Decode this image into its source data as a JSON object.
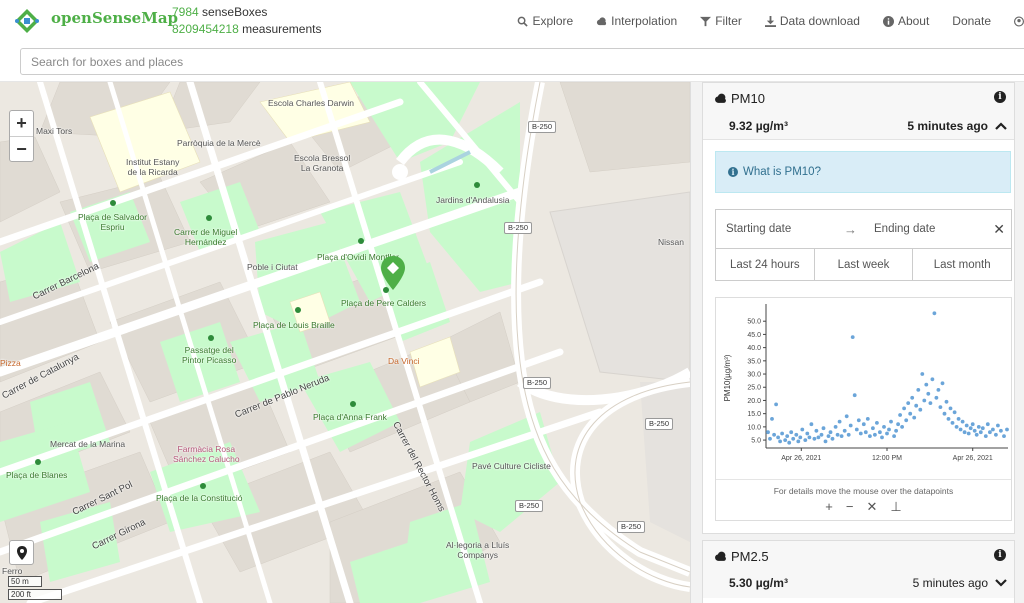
{
  "header": {
    "brand": "openSenseMap",
    "boxes_count": "7984",
    "boxes_label": "senseBoxes",
    "measurements_count": "8209454218",
    "measurements_label": "measurements",
    "nav": [
      {
        "label": "Explore",
        "icon": "search-icon"
      },
      {
        "label": "Interpolation",
        "icon": "cloud-icon"
      },
      {
        "label": "Filter",
        "icon": "filter-icon"
      },
      {
        "label": "Data download",
        "icon": "download-icon"
      },
      {
        "label": "About",
        "icon": "info-icon"
      },
      {
        "label": "Donate",
        "icon": ""
      }
    ],
    "search_placeholder": "Search for boxes and places"
  },
  "map": {
    "labels": {
      "maxi_tors": "Maxi Tors",
      "escola_darwin": "Escola Charles Darwin",
      "parroquia": "Parròquia de la Mercè",
      "institut": "Institut Estany\nde la Ricarda",
      "escola_bressol": "Escola Bressol\nLa Granota",
      "jardins": "Jardins d'Andalusia",
      "placa_salvador": "Plaça de Salvador\nEspriu",
      "carrer_miguel": "Carrer de Miguel\nHernández",
      "poble_ciutat": "Poble i Ciutat",
      "placa_ovidi": "Plaça d'Ovidi Montllor",
      "placa_pere": "Plaça de Pere Calders",
      "nissan": "Nissan",
      "carrer_barcelona": "Carrer Barcelona",
      "placa_louis": "Plaça de Louis Braille",
      "passatge": "Passatge del\nPintor Picasso",
      "da_vinci": "Da Vinci",
      "pizza": "Pizza",
      "carrer_catalunya": "Carrer de Catalunya",
      "carrer_pablo": "Carrer de Pablo Neruda",
      "placa_anna": "Plaça d'Anna Frank",
      "mercat": "Mercat de la Marina",
      "farmacia": "Farmàcia Rosa\nSánchez Calucho",
      "carrer_rector": "Carrer del Rector Homs",
      "pave": "Pavé Culture Cicliste",
      "placa_blanes": "Plaça de Blanes",
      "carrer_sant_pol": "Carrer Sant Pol",
      "placa_constitucio": "Plaça de la Constitució",
      "carrer_girona": "Carrer Girona",
      "alegoria": "Al·legoria a Lluís\nCompanys",
      "ferro": "Ferro"
    },
    "road_shields": [
      "B-250",
      "B-250",
      "B-250",
      "B-250",
      "B-250",
      "B-250"
    ],
    "zoom_in": "+",
    "zoom_out": "−",
    "scale_metric": "50 m",
    "scale_imperial": "200 ft"
  },
  "sidebar": {
    "pm10": {
      "title": "PM10",
      "value": "9.32 µg/m³",
      "updated": "5 minutes ago",
      "what_is": "What is PM10?",
      "start_date": "Starting date",
      "end_date": "Ending date",
      "quick_ranges": [
        "Last 24 hours",
        "Last week",
        "Last month"
      ],
      "hint": "For details move the mouse over the datapoints",
      "tools": [
        "+",
        "−",
        "✕",
        "⊥"
      ]
    },
    "pm25": {
      "title": "PM2.5",
      "value": "5.30 µg/m³",
      "updated": "5 minutes ago"
    }
  },
  "colors": {
    "brand_green": "#4eaf47",
    "info_bg": "#d9edf7",
    "info_text": "#31708f",
    "park": "#c8facc",
    "point": "#5b9bd5"
  },
  "chart_data": {
    "type": "scatter",
    "ylabel": "PM10(µg/m³)",
    "y_ticks": [
      "5.0",
      "10.0",
      "15.0",
      "20.0",
      "25.0",
      "30.0",
      "35.0",
      "40.0",
      "45.0",
      "50.0"
    ],
    "x_ticks": [
      "Apr 26, 2021",
      "12:00 PM",
      "Apr 26, 2021"
    ],
    "ylim": [
      2,
      55
    ],
    "grid": false,
    "x_hours": [
      0,
      1,
      2,
      3,
      4,
      5,
      6,
      7,
      8,
      9,
      10,
      11,
      12,
      13,
      14,
      15,
      16,
      17,
      18,
      19,
      20,
      21,
      22,
      23,
      24
    ],
    "series": [
      {
        "values_summary": [
          [
            0.2,
            8.0
          ],
          [
            0.4,
            5.5
          ],
          [
            0.6,
            13.0
          ],
          [
            0.8,
            7.0
          ],
          [
            1.0,
            18.5
          ],
          [
            1.2,
            6.0
          ],
          [
            1.4,
            4.5
          ],
          [
            1.6,
            7.5
          ],
          [
            1.9,
            5.0
          ],
          [
            2.1,
            6.5
          ],
          [
            2.3,
            4.0
          ],
          [
            2.5,
            8.0
          ],
          [
            2.7,
            5.5
          ],
          [
            3.0,
            7.0
          ],
          [
            3.2,
            4.5
          ],
          [
            3.4,
            6.0
          ],
          [
            3.6,
            9.0
          ],
          [
            3.9,
            5.0
          ],
          [
            4.1,
            7.5
          ],
          [
            4.3,
            6.0
          ],
          [
            4.5,
            11.0
          ],
          [
            4.8,
            5.5
          ],
          [
            5.0,
            8.5
          ],
          [
            5.2,
            6.0
          ],
          [
            5.5,
            7.0
          ],
          [
            5.7,
            9.5
          ],
          [
            5.9,
            4.5
          ],
          [
            6.2,
            6.5
          ],
          [
            6.4,
            8.0
          ],
          [
            6.6,
            5.5
          ],
          [
            6.9,
            10.0
          ],
          [
            7.1,
            7.0
          ],
          [
            7.3,
            12.0
          ],
          [
            7.5,
            6.5
          ],
          [
            7.8,
            8.5
          ],
          [
            8.0,
            14.0
          ],
          [
            8.2,
            7.0
          ],
          [
            8.4,
            10.5
          ],
          [
            8.6,
            44.0
          ],
          [
            8.8,
            22.0
          ],
          [
            9.0,
            9.0
          ],
          [
            9.2,
            12.5
          ],
          [
            9.4,
            7.5
          ],
          [
            9.7,
            11.0
          ],
          [
            9.9,
            8.0
          ],
          [
            10.1,
            13.0
          ],
          [
            10.3,
            6.5
          ],
          [
            10.6,
            9.5
          ],
          [
            10.8,
            7.0
          ],
          [
            11.0,
            11.5
          ],
          [
            11.3,
            8.0
          ],
          [
            11.5,
            6.0
          ],
          [
            11.7,
            10.0
          ],
          [
            12.0,
            7.5
          ],
          [
            12.2,
            9.0
          ],
          [
            12.4,
            12.0
          ],
          [
            12.7,
            6.5
          ],
          [
            12.9,
            8.5
          ],
          [
            13.1,
            11.0
          ],
          [
            13.3,
            14.5
          ],
          [
            13.5,
            10.0
          ],
          [
            13.7,
            17.0
          ],
          [
            13.9,
            12.5
          ],
          [
            14.1,
            19.0
          ],
          [
            14.3,
            15.0
          ],
          [
            14.5,
            21.0
          ],
          [
            14.7,
            13.5
          ],
          [
            14.9,
            18.0
          ],
          [
            15.1,
            24.0
          ],
          [
            15.3,
            16.5
          ],
          [
            15.5,
            30.0
          ],
          [
            15.7,
            20.0
          ],
          [
            15.9,
            26.0
          ],
          [
            16.1,
            22.5
          ],
          [
            16.3,
            19.0
          ],
          [
            16.5,
            28.0
          ],
          [
            16.7,
            53.0
          ],
          [
            16.9,
            21.0
          ],
          [
            17.1,
            24.0
          ],
          [
            17.3,
            17.5
          ],
          [
            17.5,
            26.5
          ],
          [
            17.7,
            15.0
          ],
          [
            17.9,
            19.5
          ],
          [
            18.1,
            13.0
          ],
          [
            18.3,
            17.0
          ],
          [
            18.5,
            11.5
          ],
          [
            18.7,
            15.5
          ],
          [
            18.9,
            10.0
          ],
          [
            19.1,
            13.0
          ],
          [
            19.3,
            9.0
          ],
          [
            19.5,
            12.0
          ],
          [
            19.7,
            8.0
          ],
          [
            19.9,
            10.5
          ],
          [
            20.1,
            7.5
          ],
          [
            20.3,
            9.5
          ],
          [
            20.5,
            11.0
          ],
          [
            20.7,
            8.5
          ],
          [
            20.9,
            7.0
          ],
          [
            21.1,
            10.0
          ],
          [
            21.3,
            8.0
          ],
          [
            21.5,
            9.5
          ],
          [
            21.8,
            6.5
          ],
          [
            22.0,
            11.0
          ],
          [
            22.2,
            8.0
          ],
          [
            22.5,
            9.0
          ],
          [
            22.8,
            7.0
          ],
          [
            23.0,
            10.5
          ],
          [
            23.3,
            8.5
          ],
          [
            23.6,
            6.5
          ],
          [
            23.9,
            9.0
          ]
        ]
      }
    ]
  }
}
